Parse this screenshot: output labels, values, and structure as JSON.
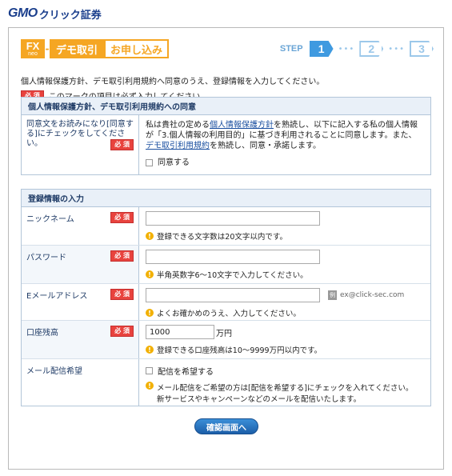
{
  "logo": {
    "brand": "GMO",
    "product": "クリック証券"
  },
  "header": {
    "fx_badge": "FX",
    "fx_sub": "neo",
    "demo": "デモ取引",
    "apply": "お申し込み"
  },
  "steps": {
    "label": "STEP",
    "items": [
      "1",
      "2",
      "3"
    ],
    "active": 1
  },
  "intro": {
    "line1": "個人情報保護方針、デモ取引利用規約へ同意のうえ、登録情報を入力してください。",
    "line2": "このマークの項目は必ず入力してください。"
  },
  "required_label": "必 須",
  "consent": {
    "title": "個人情報保護方針、デモ取引利用規約への同意",
    "left_text": "同意文をお読みになり[同意する]にチェックをしてください。",
    "text_a": "私は貴社の定める",
    "link_privacy": "個人情報保護方針",
    "text_b": "を熟読し、以下に記入する私の個人情報が「3.個人情報の利用目的」に基づき利用されることに同意します。また、",
    "link_terms": "デモ取引利用規約",
    "text_c": "を熟読し、同意・承諾します。",
    "checkbox_label": "同意する"
  },
  "registration": {
    "title": "登録情報の入力",
    "nickname": {
      "label": "ニックネーム",
      "value": "",
      "hint": "登録できる文字数は20文字以内です。"
    },
    "password": {
      "label": "パスワード",
      "value": "",
      "hint": "半角英数字6～10文字で入力してください。"
    },
    "email": {
      "label": "Eメールアドレス",
      "value": "",
      "example_badge": "例",
      "example": "ex@click-sec.com",
      "hint": "よくお確かめのうえ、入力してください。"
    },
    "balance": {
      "label": "口座残高",
      "value": "1000",
      "unit": "万円",
      "hint": "登録できる口座残高は10～9999万円以内です。"
    },
    "mail": {
      "label": "メール配信希望",
      "checkbox_label": "配信を希望する",
      "hint1": "メール配信をご希望の方は[配信を希望する]にチェックを入れてください。",
      "hint2": "新サービスやキャンペーンなどのメールを配信いたします。"
    }
  },
  "confirm_button": "確認画面へ",
  "colors": {
    "accent": "#f5a623",
    "step_active": "#3f9ae0",
    "required": "#e8433e",
    "section_bg": "#e9f0f8"
  },
  "icons": {
    "info": "info-icon"
  }
}
